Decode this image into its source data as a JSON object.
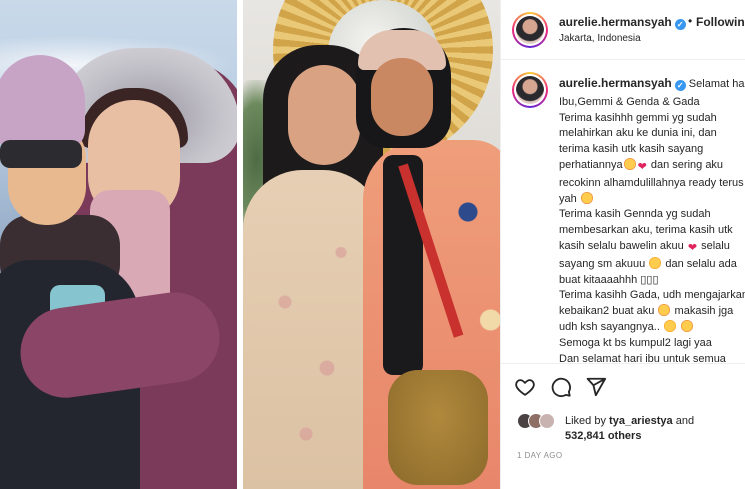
{
  "post": {
    "username": "aurelie.hermansyah",
    "verified_icon": "verified-badge-icon",
    "dot": "•",
    "follow_label": "Following",
    "location": "Jakarta, Indonesia"
  },
  "caption": {
    "username": "aurelie.hermansyah",
    "lines": [
      "Selamat hari",
      "Ibu,Gemmi & Genda & Gada",
      "Terima kasihhh gemmi yg sudah",
      "melahirkan aku ke dunia ini, dan",
      "terima kasih utk kasih sayang",
      "perhatiannya",
      "dan sering aku",
      "recokinn alhamdulillahnya ready terus",
      "yah",
      "Terima kasih Gennda yg sudah",
      "membesarkan aku, terima kasih utk",
      "kasih selalu bawelin akuu",
      "selalu",
      "sayang sm akuuu",
      "dan selalu ada",
      "buat kitaaaahhh",
      "Terima kasihh Gada, udh mengajarkan",
      "kebaikan2 buat aku",
      "makasih jga",
      "udh ksh sayangnya..",
      "Semoga kt bs kumpul2 lagi yaa",
      "Dan selamat hari ibu untuk semua"
    ],
    "boxes": "▯▯▯"
  },
  "actions": {
    "like_icon": "heart-icon",
    "comment_icon": "comment-icon",
    "share_icon": "send-icon"
  },
  "likes": {
    "liked_by_prefix": "Liked by",
    "liked_by_user": "tya_ariestya",
    "and": "and",
    "count": "532,841 others"
  },
  "timestamp": "1 day ago",
  "colors": {
    "verified": "#3897f0",
    "text": "#262626",
    "muted": "#8e8e8e",
    "heart": "#e0245e"
  }
}
